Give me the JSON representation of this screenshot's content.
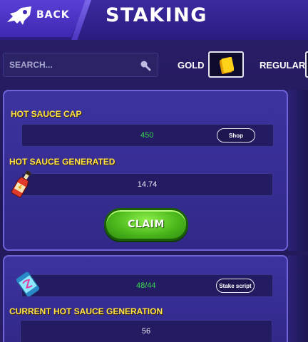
{
  "header": {
    "back_label": "BACK",
    "title": "STAKING"
  },
  "search": {
    "placeholder": "SEARCH..."
  },
  "filters": {
    "gold_label": "GOLD",
    "regular_label": "REGULAR"
  },
  "panel1": {
    "cap_title": "HOT SAUCE CAP",
    "cap_value": "450",
    "shop_label": "Shop",
    "generated_title": "HOT SAUCE GENERATED",
    "generated_value": "14.74",
    "claim_label": "CLAIM"
  },
  "panel2": {
    "stake_value": "48/44",
    "stake_script_label": "Stake script",
    "generation_title": "CURRENT HOT SAUCE GENERATION",
    "generation_value": "56"
  },
  "colors": {
    "accent_yellow": "#ffe14a",
    "value_green": "#3ad64c",
    "claim_green": "#4cb91c"
  },
  "icons": {
    "back": "rocket-ship-icon",
    "search": "search-icon",
    "gold": "gold-card-icon",
    "generated": "hot-sauce-bottle-icon",
    "stake": "energy-capsule-icon"
  }
}
